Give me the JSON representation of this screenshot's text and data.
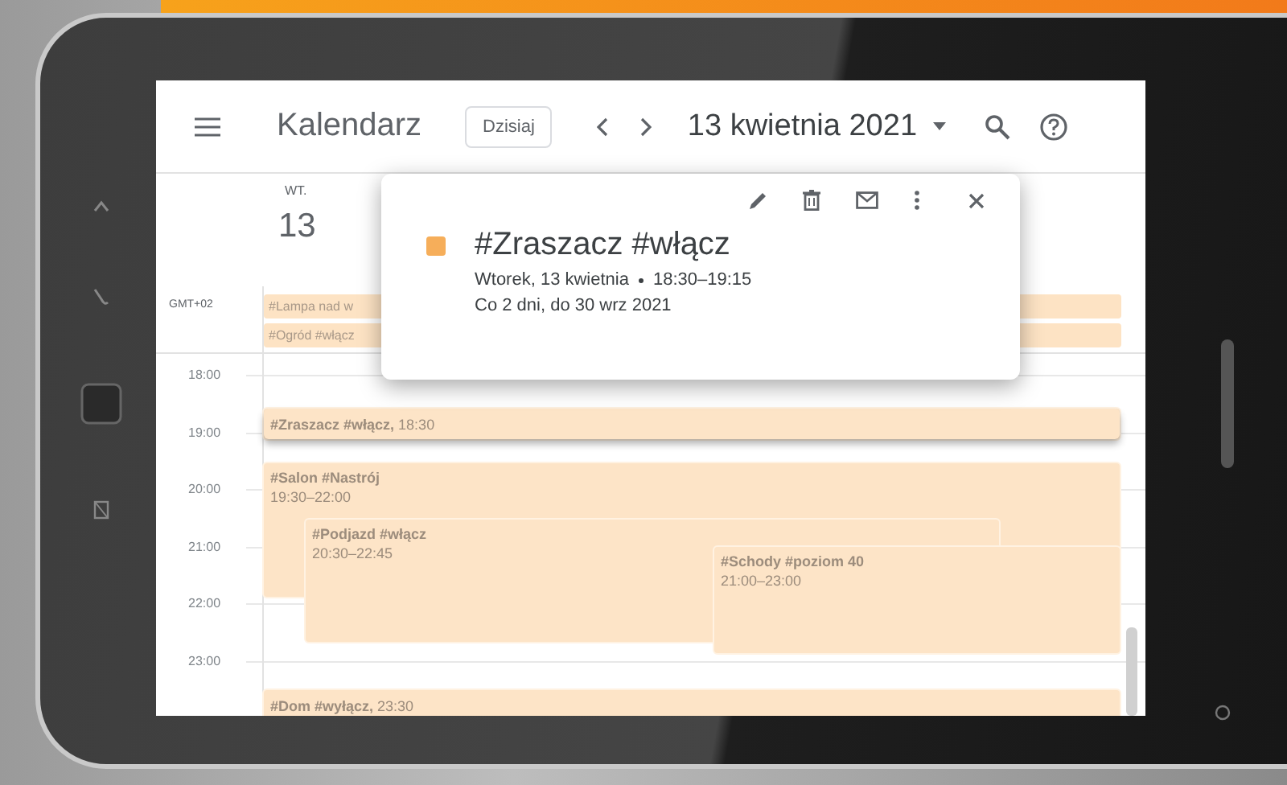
{
  "header": {
    "title": "Kalendarz",
    "today_button": "Dzisiaj",
    "date": "13 kwietnia 2021"
  },
  "day": {
    "weekday": "WT.",
    "number": "13"
  },
  "timezone": "GMT+02",
  "all_day_events": [
    {
      "title": "#Lampa nad w"
    },
    {
      "title": "#Ogród #włącz"
    }
  ],
  "hours": [
    "18:00",
    "19:00",
    "20:00",
    "21:00",
    "22:00",
    "23:00"
  ],
  "events": [
    {
      "kind": "inline",
      "title": "#Zraszacz #włącz,",
      "time": "18:30",
      "selected": true
    },
    {
      "kind": "block",
      "title": "#Salon #Nastrój",
      "time": "19:30–22:00",
      "selected": false
    },
    {
      "kind": "block",
      "title": "#Podjazd #włącz",
      "time": "20:30–22:45",
      "selected": false
    },
    {
      "kind": "block",
      "title": "#Schody #poziom 40",
      "time": "21:00–23:00",
      "selected": false
    },
    {
      "kind": "inline",
      "title": "#Dom #wyłącz,",
      "time": "23:30",
      "selected": false
    }
  ],
  "popup": {
    "title": "#Zraszacz #włącz",
    "date": "Wtorek, 13 kwietnia",
    "time": "18:30–19:15",
    "recurrence": "Co 2 dni, do 30 wrz 2021"
  }
}
